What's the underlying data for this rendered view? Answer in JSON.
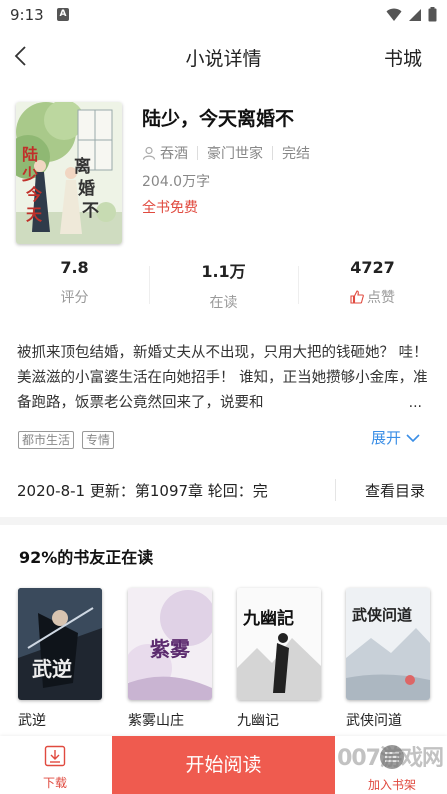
{
  "status_bar": {
    "time": "9:13",
    "app_icon_letter": "A"
  },
  "nav": {
    "title": "小说详情",
    "store": "书城"
  },
  "book": {
    "title": "陆少，今天离婚不",
    "cover_title": "陆少今天离婚不",
    "author": "吞酒",
    "category": "豪门世家",
    "status": "完结",
    "words": "204.0万字",
    "price": "全书免费"
  },
  "stats": [
    {
      "value": "7.8",
      "label": "评分"
    },
    {
      "value": "1.1万",
      "label": "在读"
    },
    {
      "value": "4727",
      "label": "点赞"
    }
  ],
  "intro": {
    "text": "被抓来顶包结婚，新婚丈夫从不出现，只用大把的钱砸她？ 哇！美滋滋的小富婆生活在向她招手！ 谁知，正当她攒够小金库，准备跑路，饭票老公竟然回来了，说要和",
    "ellipsis": "...",
    "expand": "展开"
  },
  "tags": [
    "都市生活",
    "专情"
  ],
  "update": {
    "text": "2020-8-1 更新：第1097章 轮回：完",
    "catalog": "查看目录"
  },
  "recommend": {
    "title": "92%的书友正在读",
    "books": [
      {
        "name": "武逆",
        "cover_text": "武逆"
      },
      {
        "name": "紫雾山庄",
        "cover_text": "紫雾"
      },
      {
        "name": "九幽记",
        "cover_text": "九幽記"
      },
      {
        "name": "武侠问道",
        "cover_text": "武侠问道"
      }
    ]
  },
  "bottom": {
    "download": "下载",
    "start": "开始阅读",
    "shelf": "加入书架"
  },
  "watermark": "007游戏网",
  "colors": {
    "accent": "#ef5b4f",
    "link": "#3a8ee6",
    "price": "#e04a3f"
  }
}
